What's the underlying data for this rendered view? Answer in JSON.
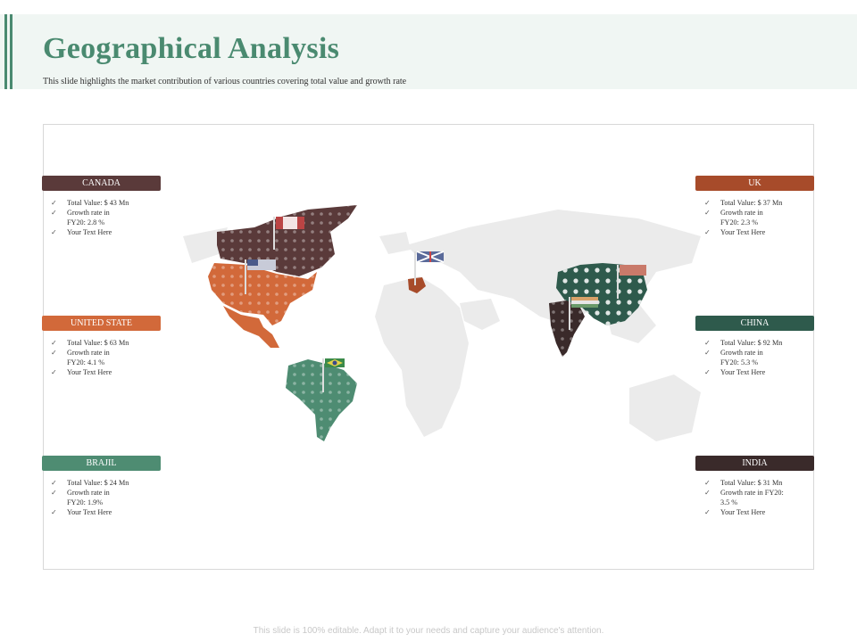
{
  "title": "Geographical Analysis",
  "subtitle": "This slide highlights the market contribution of various countries covering total value and growth rate",
  "footer": "This slide is 100% editable. Adapt it to your needs and capture your audience's attention.",
  "colors": {
    "accent": "#4a8a70",
    "brown_dark": "#5a3a3a",
    "rust": "#a74b2a",
    "orange": "#d2693a",
    "green_dark": "#2e5a4c",
    "green_mid": "#4e8c72",
    "dark_plum": "#3a2a2a",
    "land": "#ebebeb"
  },
  "cards": {
    "canada": {
      "name": "CANADA",
      "items": [
        "Total Value: $ 43 Mn",
        "Growth rate in",
        "FY20: 2.8 %",
        "Your Text Here"
      ]
    },
    "united_state": {
      "name": "UNITED STATE",
      "items": [
        "Total Value: $ 63 Mn",
        "Growth rate in",
        "FY20: 4.1 %",
        "Your Text Here"
      ]
    },
    "brajil": {
      "name": "BRAJIL",
      "items": [
        "Total Value: $ 24 Mn",
        "Growth rate in",
        "FY20: 1.9%",
        "Your Text Here"
      ]
    },
    "uk": {
      "name": "UK",
      "items": [
        "Total Value: $ 37 Mn",
        "Growth rate in",
        "FY20: 2.3 %",
        "Your Text Here"
      ]
    },
    "china": {
      "name": "CHINA",
      "items": [
        "Total Value: $ 92 Mn",
        "Growth rate in",
        "FY20: 5.3 %",
        "Your Text Here"
      ]
    },
    "india": {
      "name": "INDIA",
      "items": [
        "Total Value: $ 31 Mn",
        "Growth rate in FY20:",
        "3.5 %",
        "Your Text Here"
      ]
    }
  },
  "check_glyph": "✓"
}
